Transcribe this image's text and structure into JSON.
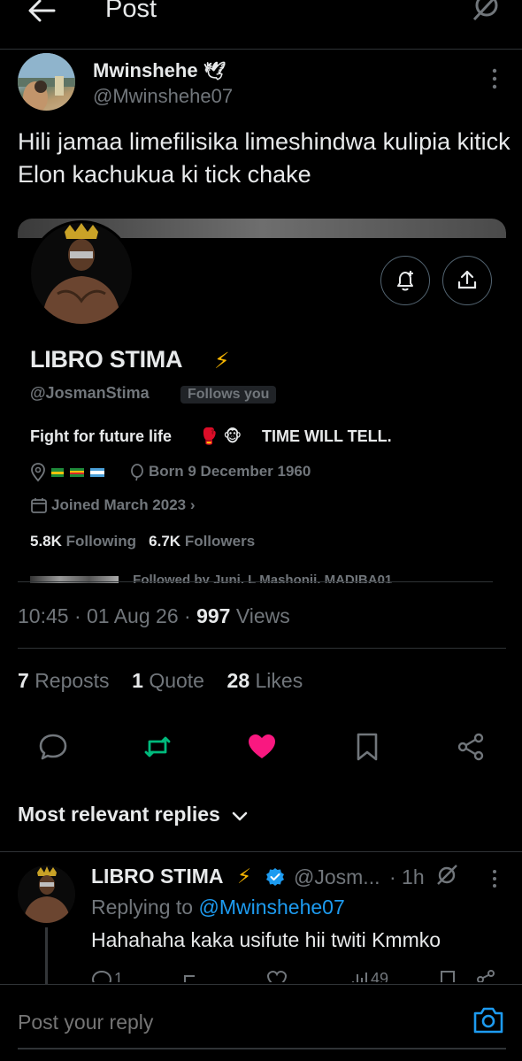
{
  "header": {
    "title": "Post"
  },
  "author": {
    "name": "Mwinshehe",
    "badge": "🕊",
    "handle": "@Mwinshehe07"
  },
  "tweet": {
    "text": "Hili jamaa limefilisika limeshindwa kulipia kitick Elon kachukua ki tick chake"
  },
  "profile_card": {
    "name": "LIBRO STIMA",
    "bolt": "⚡",
    "handle": "@JosmanStima",
    "follows_you": "Follows you",
    "bio": "Fight for future life",
    "bio_icons": "🥊 🐵",
    "bio_rest": "TIME WILL TELL.",
    "born": "Born 9 December 1960",
    "joined": "Joined March 2023",
    "following_count": "5.8K",
    "following_label": "Following",
    "followers_count": "6.7K",
    "followers_label": "Followers",
    "followed_by": "Followed by Juni, L Mashonji, MADIBA01"
  },
  "meta": {
    "time": "10:45",
    "date": "01 Aug 26",
    "views_count": "997",
    "views_label": "Views"
  },
  "engagement": {
    "reposts_count": "7",
    "reposts_label": "Reposts",
    "quotes_count": "1",
    "quotes_label": "Quote",
    "likes_count": "28",
    "likes_label": "Likes"
  },
  "replies": {
    "sort_label": "Most relevant replies"
  },
  "reply": {
    "name": "LIBRO STIMA",
    "bolt": "⚡",
    "handle": "@Josm...",
    "time": "· 1h",
    "replying_prefix": "Replying to",
    "replying_handle": "@Mwinshehe07",
    "text": "Hahahaha kaka usifute hii twiti Kmmko",
    "reply_count": "1",
    "views_count": "49"
  },
  "composer": {
    "placeholder": "Post your reply"
  },
  "colors": {
    "background": "#000000",
    "accent": "#1d9bf0",
    "like": "#f91880",
    "repost": "#00ba7c",
    "muted": "#71767b"
  },
  "icons": [
    "back-arrow-icon",
    "grok-icon",
    "more-icon",
    "notify-icon",
    "share-icon",
    "location-icon",
    "balloon-icon",
    "calendar-icon",
    "reply-icon",
    "repost-icon",
    "like-icon",
    "bookmark-icon",
    "chevron-down-icon",
    "verified-icon",
    "camera-icon"
  ]
}
